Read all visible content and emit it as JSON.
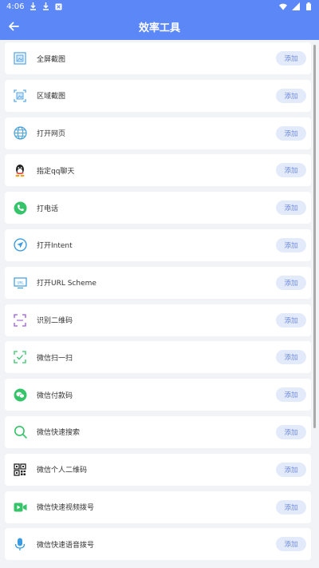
{
  "status": {
    "time": "4:06"
  },
  "appbar": {
    "title": "效率工具"
  },
  "tools": [
    {
      "label": "全屏截图",
      "icon": "fullscreen-screenshot-icon",
      "button": "添加"
    },
    {
      "label": "区域截图",
      "icon": "region-screenshot-icon",
      "button": "添加"
    },
    {
      "label": "打开网页",
      "icon": "globe-icon",
      "button": "添加"
    },
    {
      "label": "指定qq聊天",
      "icon": "qq-penguin-icon",
      "button": "添加"
    },
    {
      "label": "打电话",
      "icon": "phone-icon",
      "button": "添加"
    },
    {
      "label": "打开Intent",
      "icon": "send-arrow-icon",
      "button": "添加"
    },
    {
      "label": "打开URL Scheme",
      "icon": "url-monitor-icon",
      "button": "添加"
    },
    {
      "label": "识别二维码",
      "icon": "qr-scan-frame-icon",
      "button": "添加"
    },
    {
      "label": "微信扫一扫",
      "icon": "wechat-scan-icon",
      "button": "添加"
    },
    {
      "label": "微信付款码",
      "icon": "wechat-logo-icon",
      "button": "添加"
    },
    {
      "label": "微信快速搜索",
      "icon": "search-icon",
      "button": "添加"
    },
    {
      "label": "微信个人二维码",
      "icon": "qr-code-icon",
      "button": "添加"
    },
    {
      "label": "微信快速视频拨号",
      "icon": "video-call-icon",
      "button": "添加"
    },
    {
      "label": "微信快速语音拨号",
      "icon": "microphone-icon",
      "button": "添加"
    }
  ],
  "colors": {
    "accent": "#5b87f7",
    "button_bg": "#e3ebfb",
    "button_text": "#6e8ae0"
  }
}
